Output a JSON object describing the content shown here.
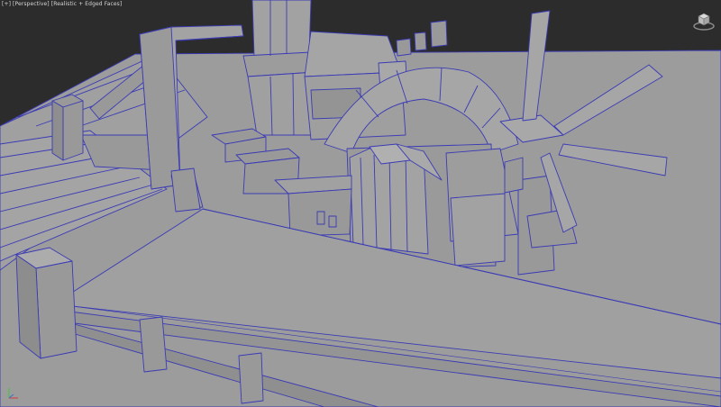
{
  "viewport": {
    "menu_label": "[+]",
    "view_label": "[Perspective]",
    "shading_label": "[Realistic + Edged Faces]"
  },
  "icons": {
    "viewcube": "viewcube-icon",
    "axis": "axis-tripod-icon"
  },
  "colors": {
    "background": "#2c2c2c",
    "geometry_face": "#9a9a9a",
    "geometry_edge": "#3c3cb4",
    "label_text": "#d6d6d6"
  }
}
